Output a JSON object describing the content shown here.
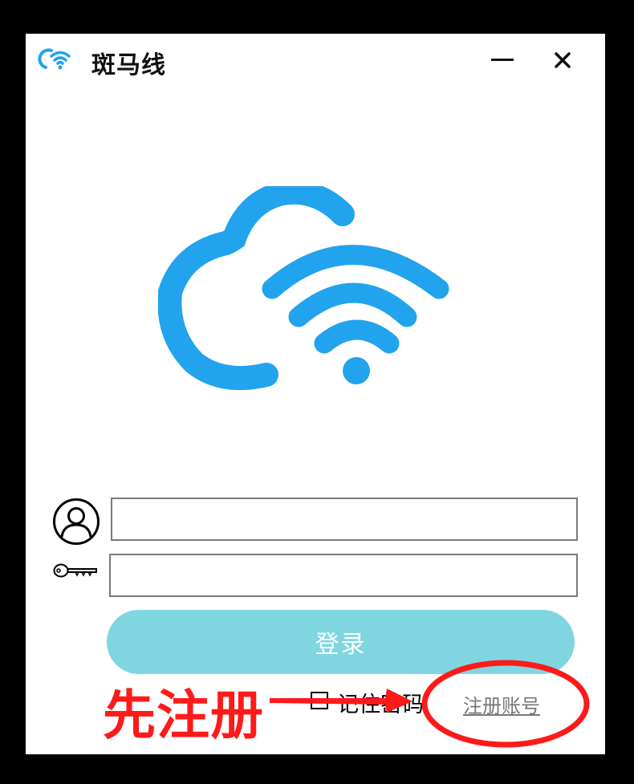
{
  "window": {
    "title": "斑马线",
    "app_icon": "cloud-wifi-icon",
    "minimize_icon": "minimize-icon",
    "close_icon": "close-icon"
  },
  "logo": {
    "icon": "cloud-wifi-logo",
    "color": "#22a3ee"
  },
  "form": {
    "username_icon": "user-icon",
    "username_value": "",
    "password_icon": "key-icon",
    "password_value": "",
    "login_label": "登录",
    "login_color": "#7fd6e0",
    "remember_label": "记住密码",
    "remember_checked": false,
    "register_label": "注册账号"
  },
  "annotation": {
    "text": "先注册",
    "color": "#ff1a1a"
  }
}
